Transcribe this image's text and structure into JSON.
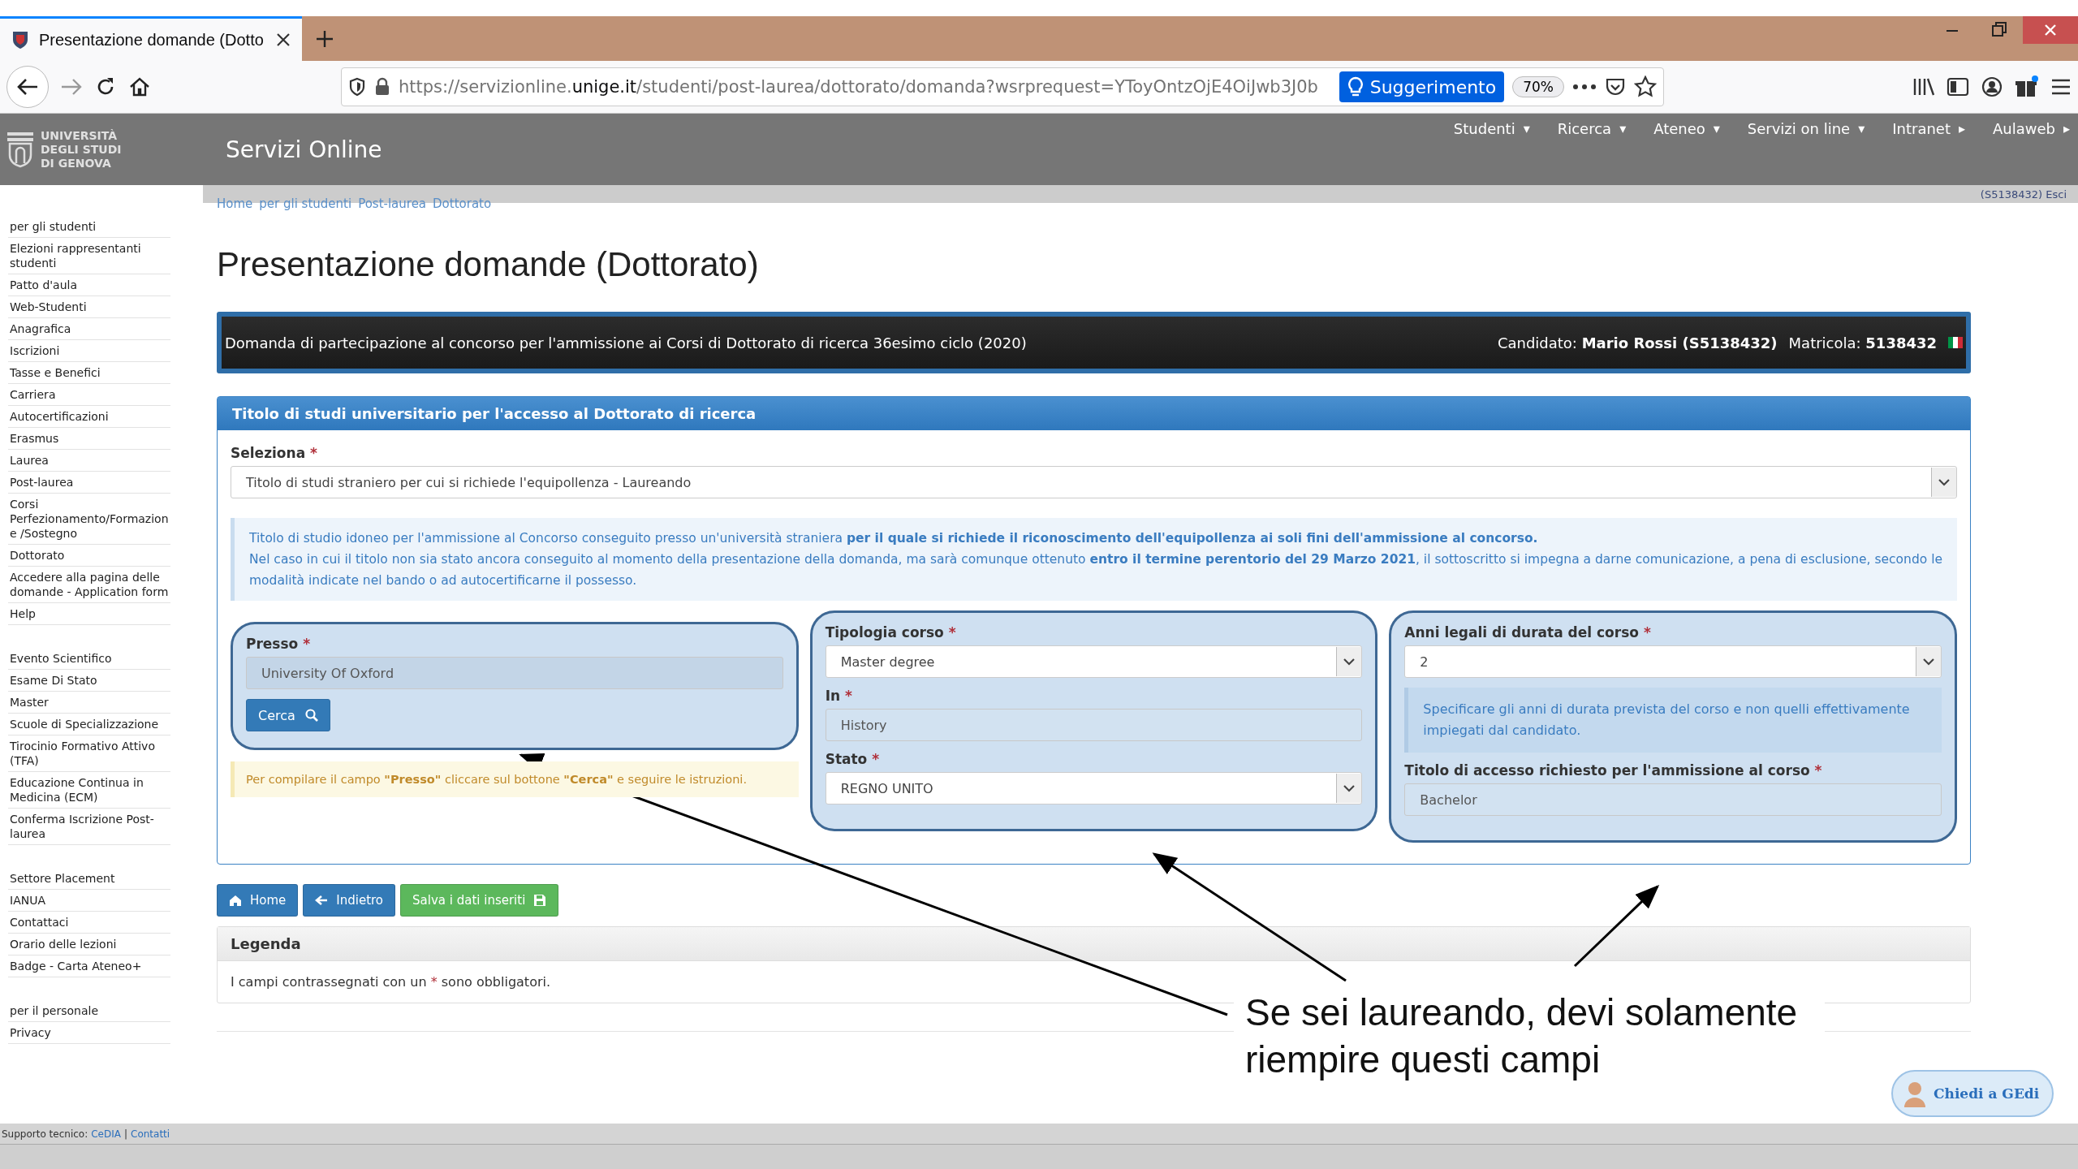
{
  "browser": {
    "tab_title": "Presentazione domande (Dotto",
    "url_prefix": "https://servizionline.",
    "url_domain": "unige.it",
    "url_rest": "/studenti/post-laurea/dottorato/domanda?wsrprequest=YToyOntzOjE4OiJwb3J0b",
    "suggestion_button": "Suggerimento",
    "zoom": "70%"
  },
  "header": {
    "logo_lines": [
      "UNIVERSITÀ",
      "DEGLI STUDI",
      "DI GENOVA"
    ],
    "site_title": "Servizi Online",
    "nav": [
      {
        "label": "Studenti",
        "caret": "▾"
      },
      {
        "label": "Ricerca",
        "caret": "▾"
      },
      {
        "label": "Ateneo",
        "caret": "▾"
      },
      {
        "label": "Servizi on line",
        "caret": "▾"
      },
      {
        "label": "Intranet",
        "caret": "▸"
      },
      {
        "label": "Aulaweb",
        "caret": "▸"
      }
    ],
    "user_link": "(S5138432) Esci"
  },
  "sidebar": {
    "groups": [
      [
        "per gli studenti",
        "Elezioni rappresentanti studenti",
        "Patto d'aula",
        "Web-Studenti",
        "Anagrafica",
        "Iscrizioni",
        "Tasse e Benefici",
        "Carriera",
        "Autocertificazioni",
        "Erasmus",
        "Laurea",
        "Post-laurea",
        "Corsi Perfezionamento/Formazione /Sostegno",
        "Dottorato",
        "Accedere alla pagina delle domande - Application form",
        "Help"
      ],
      [
        "Evento Scientifico",
        "Esame Di Stato",
        "Master",
        "Scuole di Specializzazione",
        "Tirocinio Formativo Attivo (TFA)",
        "Educazione Continua in Medicina (ECM)",
        "Conferma Iscrizione Post-laurea"
      ],
      [
        "Settore Placement",
        "IANUA",
        "Contattaci",
        "Orario delle lezioni",
        "Badge - Carta Ateneo+"
      ],
      [
        "per il personale",
        "Privacy"
      ]
    ]
  },
  "breadcrumb": [
    "Home",
    "per gli studenti",
    "Post-laurea",
    "Dottorato"
  ],
  "page_title": "Presentazione domande (Dottorato)",
  "banner": {
    "title": "Domanda di partecipazione al concorso per l'ammissione ai Corsi di Dottorato di ricerca 36esimo ciclo (2020)",
    "candidate_label": "Candidato:",
    "candidate": "Mario Rossi (S5138432)",
    "matricola_label": "Matricola:",
    "matricola": "5138432"
  },
  "panel": {
    "title": "Titolo di studi universitario per l'accesso al Dottorato di ricerca",
    "select": {
      "label": "Seleziona",
      "required": "*",
      "value": "Titolo di studi straniero per cui si richiede l'equipollenza - Laureando"
    },
    "info": [
      "Titolo di studio idoneo per l'ammissione al Concorso conseguito presso un'università straniera **per il quale si richiede il riconoscimento dell'equipollenza ai soli fini dell'ammissione al concorso.**",
      "Nel caso in cui il titolo non sia stato ancora conseguito al momento della presentazione della domanda, ma sarà comunque ottenuto **entro il termine perentorio del 29 Marzo 2021**, il sottoscritto si impegna a darne comunicazione, a pena di esclusione, secondo le modalità indicate nel bando o ad autocertificarne il possesso."
    ],
    "columns": [
      {
        "highlighted": true,
        "items": [
          {
            "kind": "readonly",
            "label": "Presso",
            "required": "*",
            "value": "University Of Oxford"
          },
          {
            "kind": "button",
            "label": "Cerca"
          }
        ],
        "after": [
          {
            "kind": "warning",
            "text": "Per compilare il campo **\"Presso\"** cliccare sul bottone **\"Cerca\"** e seguire le istruzioni."
          }
        ]
      },
      {
        "highlighted": true,
        "items": [
          {
            "kind": "select",
            "label": "Tipologia corso",
            "required": "*",
            "value": "Master degree"
          },
          {
            "kind": "input",
            "label": "In",
            "required": "*",
            "value": "History"
          },
          {
            "kind": "select",
            "label": "Stato",
            "required": "*",
            "value": "REGNO UNITO"
          }
        ]
      },
      {
        "highlighted": true,
        "items": [
          {
            "kind": "select",
            "label": "Anni legali di durata del corso",
            "required": "*",
            "value": "2"
          },
          {
            "kind": "note",
            "text": "Specificare gli anni di durata prevista del corso e non quelli effettivamente impiegati dal candidato."
          },
          {
            "kind": "input",
            "label": "Titolo di accesso richiesto per l'ammissione al corso",
            "required": "*",
            "value": "Bachelor"
          }
        ]
      }
    ]
  },
  "actions": [
    {
      "kind": "home",
      "label": "Home"
    },
    {
      "kind": "back",
      "label": "Indietro"
    },
    {
      "kind": "save",
      "label": "Salva i dati inseriti"
    }
  ],
  "legend": {
    "title": "Legenda",
    "before": "I campi contrassegnati con un ",
    "mark": "*",
    "after": " sono obbligatori."
  },
  "annotation": {
    "text": "Se sei laureando, devi solamente riempire questi campi"
  },
  "chat_button": "Chiedi a GEdi",
  "footer": {
    "label": "Supporto tecnico:",
    "links": [
      "CeDIA",
      "Contatti"
    ],
    "separator": "|"
  }
}
